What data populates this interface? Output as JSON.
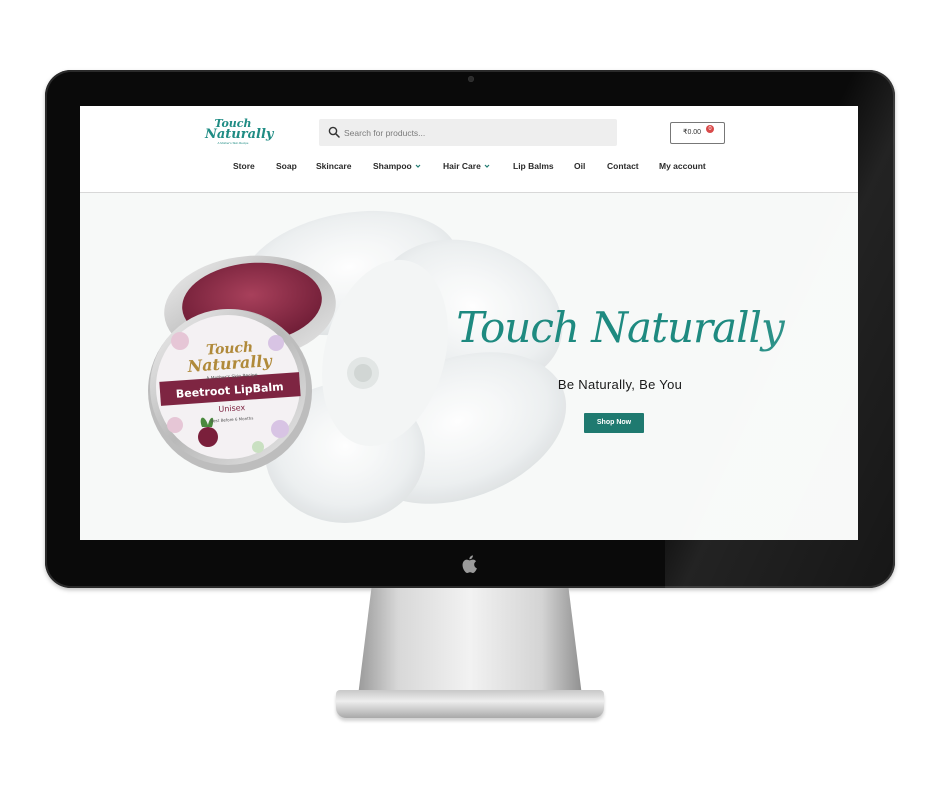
{
  "site": {
    "logo": {
      "line1": "Touch",
      "line2": "Naturally",
      "tagline": "A Mother's Skin Recipe"
    },
    "search": {
      "placeholder": "Search for products..."
    },
    "cart": {
      "price": "₹0.00",
      "count": "0"
    },
    "nav": [
      {
        "label": "Store"
      },
      {
        "label": "Soap"
      },
      {
        "label": "Skincare"
      },
      {
        "label": "Shampoo",
        "has_dropdown": true
      },
      {
        "label": "Hair Care",
        "has_dropdown": true
      },
      {
        "label": "Lip Balms"
      },
      {
        "label": "Oil"
      },
      {
        "label": "Contact"
      },
      {
        "label": "My account"
      }
    ]
  },
  "hero": {
    "brand": "Touch Naturally",
    "tagline": "Be Naturally, Be You",
    "cta": "Shop Now",
    "product": {
      "brand_line1": "Touch",
      "brand_line2": "Naturally",
      "sub": "A Mother's Skin Recipe",
      "name": "Beetroot LipBalm",
      "variant": "Unisex",
      "note": "Best Before 6 Months"
    }
  },
  "colors": {
    "accent": "#1f7a70",
    "brand_teal": "#1e8a80",
    "balm": "#8a2a45",
    "badge": "#d94a4a"
  },
  "icons": [
    "search-icon",
    "chevron-down-icon",
    "apple-logo-icon"
  ]
}
